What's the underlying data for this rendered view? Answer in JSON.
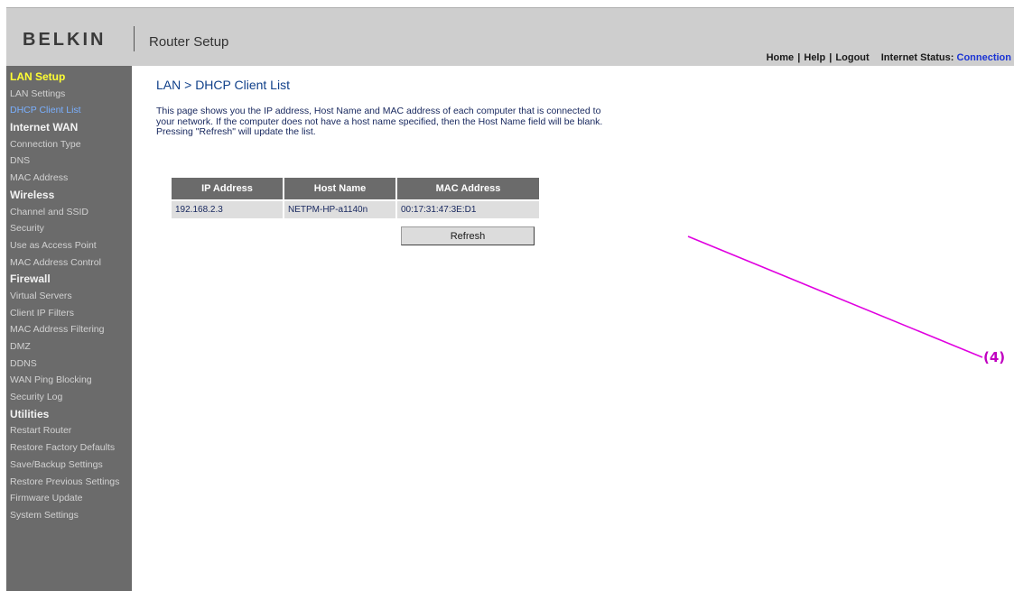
{
  "header": {
    "logo": "BELKIN",
    "title": "Router Setup",
    "links": {
      "home": "Home",
      "help": "Help",
      "logout": "Logout"
    },
    "status_label": "Internet Status:",
    "status_value": "Connection"
  },
  "sidebar": {
    "sections": [
      {
        "label": "LAN Setup",
        "items": [
          "LAN Settings",
          "DHCP Client List"
        ]
      },
      {
        "label": "Internet WAN",
        "items": [
          "Connection Type",
          "DNS",
          "MAC Address"
        ]
      },
      {
        "label": "Wireless",
        "items": [
          "Channel and SSID",
          "Security",
          "Use as Access Point",
          "MAC Address Control"
        ]
      },
      {
        "label": "Firewall",
        "items": [
          "Virtual Servers",
          "Client IP Filters",
          "MAC Address Filtering",
          "DMZ",
          "DDNS",
          "WAN Ping Blocking",
          "Security Log"
        ]
      },
      {
        "label": "Utilities",
        "items": [
          "Restart Router",
          "Restore Factory Defaults",
          "Save/Backup Settings",
          "Restore Previous Settings",
          "Firmware Update",
          "System Settings"
        ]
      }
    ]
  },
  "main": {
    "title": "LAN > DHCP Client List",
    "description": [
      "This page shows you the IP address, Host Name and MAC address of each computer that is connected to",
      "your network. If the computer does not have a host name specified, then the Host Name field will be blank.",
      "Pressing \"Refresh\" will update the list."
    ],
    "table": {
      "headers": [
        "IP Address",
        "Host Name",
        "MAC Address"
      ],
      "rows": [
        [
          "192.168.2.3",
          "NETPM-HP-a1140n",
          "00:17:31:47:3E:D1"
        ]
      ]
    },
    "refresh_label": "Refresh"
  },
  "annotation": {
    "label": "(4)",
    "color": "#e000e0"
  }
}
